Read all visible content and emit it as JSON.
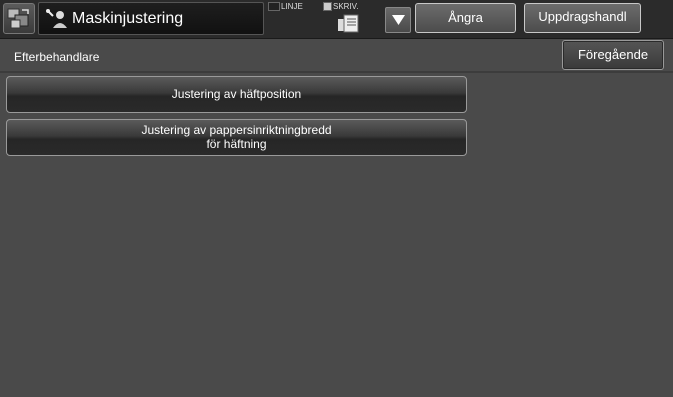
{
  "header": {
    "title": "Maskinjustering",
    "mode_linje": "LINJE",
    "mode_skriv": "SKRIV.",
    "undo_label": "Ångra",
    "jobstatus_label": "Uppdragshandl"
  },
  "page": {
    "section_label": "Efterbehandlare",
    "back_label": "Föregående"
  },
  "items": [
    {
      "line1": "Justering av häftposition"
    },
    {
      "line1": "Justering av pappersinriktningbredd",
      "line2": "för häftning"
    }
  ],
  "icons": {
    "home": "home-icon",
    "title": "wrench-person-icon",
    "skriv": "printer-icon",
    "dropdown": "triangle-down-icon"
  }
}
